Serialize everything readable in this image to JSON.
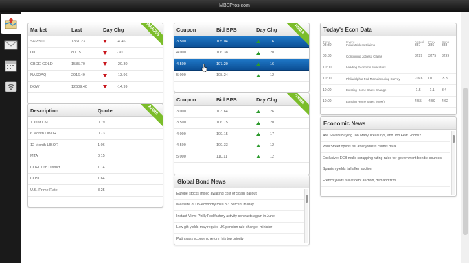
{
  "window": {
    "title": "MBSPros.com"
  },
  "sidebar": {
    "items": [
      {
        "name": "map-icon",
        "active": true
      },
      {
        "name": "mail-icon",
        "active": false
      },
      {
        "name": "calendar-icon",
        "active": false
      },
      {
        "name": "wifi-icon",
        "active": false
      }
    ]
  },
  "indices": {
    "ribbon": "INDICES",
    "headers": [
      "Market",
      "Last",
      "Day Chg"
    ],
    "rows": [
      {
        "market": "S&P 500",
        "last": "1361.23",
        "dir": "down",
        "chg": "-4.46"
      },
      {
        "market": "OIL",
        "last": "80.15",
        "dir": "down",
        "chg": "-.91"
      },
      {
        "market": "CBOE GOLD",
        "last": "1585.70",
        "dir": "down",
        "chg": "-20.30"
      },
      {
        "market": "NASDAQ",
        "last": "2916.49",
        "dir": "down",
        "chg": "-13.96"
      },
      {
        "market": "DOW",
        "last": "12609.40",
        "dir": "down",
        "chg": "-14.99"
      }
    ]
  },
  "arms": {
    "ribbon": "ARMS",
    "headers": [
      "Description",
      "Quote"
    ],
    "rows": [
      {
        "desc": "1 Year CMT",
        "quote": "0.19"
      },
      {
        "desc": "6 Month LIBOR",
        "quote": "0.73"
      },
      {
        "desc": "12 Month LIBOR",
        "quote": "1.06"
      },
      {
        "desc": "MTA",
        "quote": "0.15"
      },
      {
        "desc": "COFI 11th District",
        "quote": "1.14"
      },
      {
        "desc": "COSI",
        "quote": "1.64"
      },
      {
        "desc": "U.S. Prime Rate",
        "quote": "3.25"
      }
    ]
  },
  "fnma": {
    "ribbon": "FNMA",
    "headers": [
      "Coupon",
      "Bid BPS",
      "Day Chg"
    ],
    "rows": [
      {
        "coupon": "3.500",
        "bid": "105.04",
        "dir": "up",
        "chg": "16",
        "selected": true
      },
      {
        "coupon": "4.000",
        "bid": "106.38",
        "dir": "up",
        "chg": "20",
        "selected": false
      },
      {
        "coupon": "4.500",
        "bid": "107.20",
        "dir": "up",
        "chg": "16",
        "selected": true
      },
      {
        "coupon": "5.000",
        "bid": "108.24",
        "dir": "up",
        "chg": "12",
        "selected": false
      }
    ]
  },
  "gnma": {
    "ribbon": "GNMA",
    "headers": [
      "Coupon",
      "Bid BPS",
      "Day Chg"
    ],
    "rows": [
      {
        "coupon": "3.000",
        "bid": "103.64",
        "dir": "up",
        "chg": "26"
      },
      {
        "coupon": "3.500",
        "bid": "106.75",
        "dir": "up",
        "chg": "20"
      },
      {
        "coupon": "4.000",
        "bid": "109.15",
        "dir": "up",
        "chg": "17"
      },
      {
        "coupon": "4.500",
        "bid": "109.33",
        "dir": "up",
        "chg": "12"
      },
      {
        "coupon": "5.000",
        "bid": "110.11",
        "dir": "up",
        "chg": "12"
      }
    ]
  },
  "global_news": {
    "title": "Global Bond News",
    "items": [
      "Europe stocks mixed awaiting cost of Spain bailout",
      "Measure of US economy rose 8.3 percent in May",
      "Instant View: Philly Fed factory activity contracts again in June",
      "Low gilt yields may require UK pension rule change -minister",
      "Putin says economic reform his top priority"
    ]
  },
  "econ_data": {
    "title": "Today's Econ Data",
    "headers": [
      "Time",
      "Event",
      "Actual",
      "Prev",
      "Cons"
    ],
    "rows": [
      {
        "time": "08:30",
        "event": "Initial Jobless Claims",
        "actual": "387",
        "prev": "386",
        "cons": "388"
      },
      {
        "time": "08:30",
        "event": "Continuing Jobless Claims",
        "actual": "3299",
        "prev": "3275",
        "cons": "3299"
      },
      {
        "time": "10:00",
        "event": "Leading Economic Indicators",
        "actual": "",
        "prev": "",
        "cons": ""
      },
      {
        "time": "10:00",
        "event": "Philadelphia Fed Manufacturing Survey",
        "actual": "-16.6",
        "prev": "0.0",
        "cons": "-5.8"
      },
      {
        "time": "10:00",
        "event": "Existing Home Sales Change",
        "actual": "-1.5",
        "prev": "-1.1",
        "cons": "3.4"
      },
      {
        "time": "10:00",
        "event": "Existing Home Sales (MoM)",
        "actual": "4.55",
        "prev": "4.59",
        "cons": "4.62"
      }
    ]
  },
  "econ_news": {
    "title": "Economic News",
    "items": [
      "Are Savers Buying Too Many Treasurys, and Too Few Goods?",
      "Wall Street opens flat after jobless claims data",
      "Exclusive: ECB mulls scrapping rating rules for government bonds: sources",
      "Spanish yields fall after auction",
      "French yields fall at debt auction, demand firm"
    ]
  }
}
